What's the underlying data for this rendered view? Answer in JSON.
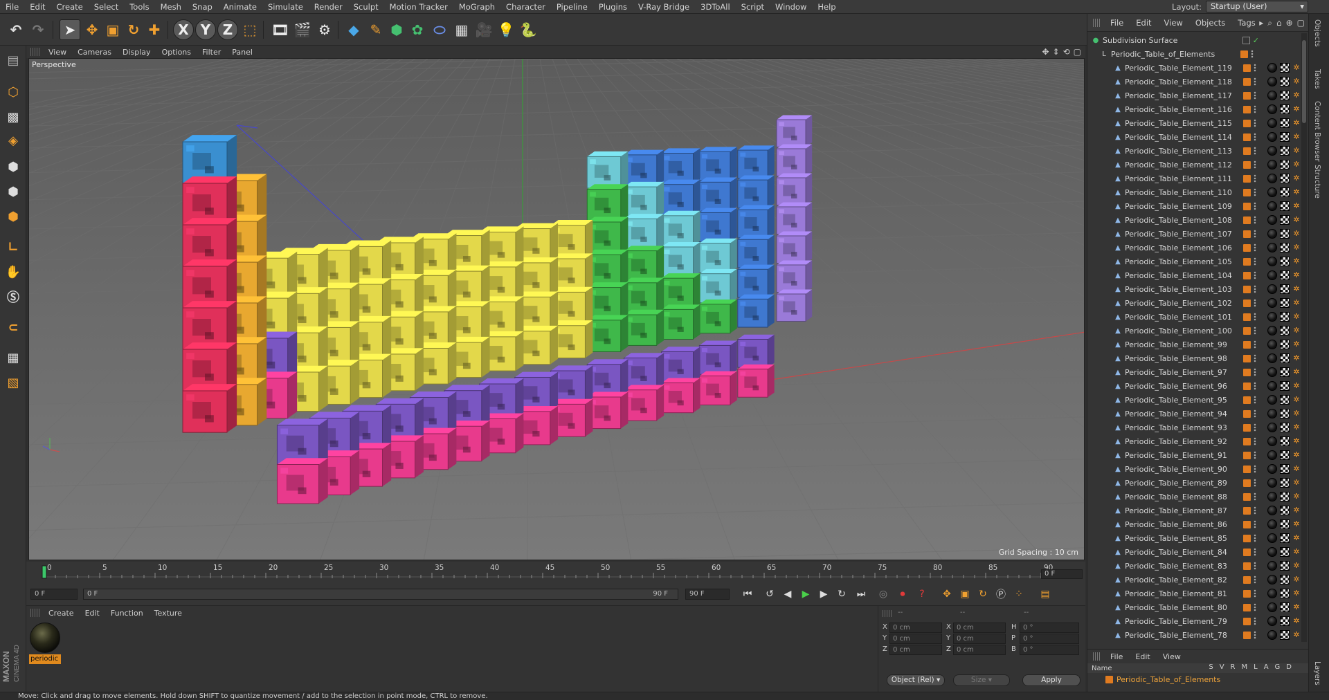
{
  "menubar": {
    "items": [
      "File",
      "Edit",
      "Create",
      "Select",
      "Tools",
      "Mesh",
      "Snap",
      "Animate",
      "Simulate",
      "Render",
      "Sculpt",
      "Motion Tracker",
      "MoGraph",
      "Character",
      "Pipeline",
      "Plugins",
      "V-Ray Bridge",
      "3DToAll",
      "Script",
      "Window",
      "Help"
    ],
    "layout_label": "Layout:",
    "layout_value": "Startup (User)"
  },
  "viewport": {
    "menu": [
      "View",
      "Cameras",
      "Display",
      "Options",
      "Filter",
      "Panel"
    ],
    "label": "Perspective",
    "grid_spacing": "Grid Spacing : 10 cm"
  },
  "timeline": {
    "ticks": [
      "0",
      "5",
      "10",
      "15",
      "20",
      "25",
      "30",
      "35",
      "40",
      "45",
      "50",
      "55",
      "60",
      "65",
      "70",
      "75",
      "80",
      "85",
      "90"
    ],
    "current_frame": "0 F"
  },
  "transport": {
    "start_field": "0 F",
    "range_start": "0 F",
    "range_end": "90 F",
    "end_field": "90 F"
  },
  "material_manager": {
    "menu": [
      "Create",
      "Edit",
      "Function",
      "Texture"
    ],
    "material_name": "periodic"
  },
  "coordinates": {
    "header_left": "--",
    "header_mid": "--",
    "header_right": "--",
    "rows": [
      {
        "axis": "X",
        "pos": "0 cm",
        "axis2": "X",
        "size": "0 cm",
        "axis3": "H",
        "rot": "0 °"
      },
      {
        "axis": "Y",
        "pos": "0 cm",
        "axis2": "Y",
        "size": "0 cm",
        "axis3": "P",
        "rot": "0 °"
      },
      {
        "axis": "Z",
        "pos": "0 cm",
        "axis2": "Z",
        "size": "0 cm",
        "axis3": "B",
        "rot": "0 °"
      }
    ],
    "mode": "Object (Rel)",
    "size_mode": "Size",
    "apply": "Apply"
  },
  "object_manager": {
    "menu": [
      "File",
      "Edit",
      "View",
      "Objects",
      "Tags"
    ],
    "root": "Subdivision Surface",
    "group": "Periodic_Table_of_Elements",
    "elements": [
      "Periodic_Table_Element_119",
      "Periodic_Table_Element_118",
      "Periodic_Table_Element_117",
      "Periodic_Table_Element_116",
      "Periodic_Table_Element_115",
      "Periodic_Table_Element_114",
      "Periodic_Table_Element_113",
      "Periodic_Table_Element_112",
      "Periodic_Table_Element_111",
      "Periodic_Table_Element_110",
      "Periodic_Table_Element_109",
      "Periodic_Table_Element_108",
      "Periodic_Table_Element_107",
      "Periodic_Table_Element_106",
      "Periodic_Table_Element_105",
      "Periodic_Table_Element_104",
      "Periodic_Table_Element_103",
      "Periodic_Table_Element_102",
      "Periodic_Table_Element_101",
      "Periodic_Table_Element_100",
      "Periodic_Table_Element_99",
      "Periodic_Table_Element_98",
      "Periodic_Table_Element_97",
      "Periodic_Table_Element_96",
      "Periodic_Table_Element_95",
      "Periodic_Table_Element_94",
      "Periodic_Table_Element_93",
      "Periodic_Table_Element_92",
      "Periodic_Table_Element_91",
      "Periodic_Table_Element_90",
      "Periodic_Table_Element_89",
      "Periodic_Table_Element_88",
      "Periodic_Table_Element_87",
      "Periodic_Table_Element_86",
      "Periodic_Table_Element_85",
      "Periodic_Table_Element_84",
      "Periodic_Table_Element_83",
      "Periodic_Table_Element_82",
      "Periodic_Table_Element_81",
      "Periodic_Table_Element_80",
      "Periodic_Table_Element_79",
      "Periodic_Table_Element_78"
    ]
  },
  "layers_manager": {
    "menu": [
      "File",
      "Edit",
      "View"
    ],
    "name_header": "Name",
    "columns": [
      "S",
      "V",
      "R",
      "M",
      "L",
      "A",
      "G",
      "D"
    ],
    "row": "Periodic_Table_of_Elements"
  },
  "side_tabs": [
    "Objects",
    "Takes",
    "Content Browser",
    "Structure"
  ],
  "layers_tab": "Layers",
  "brand": {
    "maxon": "MAXON",
    "product": "CINEMA 4D"
  },
  "status": "Move: Click and drag to move elements. Hold down SHIFT to quantize movement / add to the selection in point mode, CTRL to remove.",
  "colors": {
    "alkali": "#e0305a",
    "alkaline": "#e8a830",
    "hydrogen": "#3a8fd0",
    "transition": "#e3d84a",
    "post": "#3fb84a",
    "metalloid": "#6ec9d4",
    "nonmetal": "#3f78d0",
    "noble": "#9a7ad8",
    "lanthanide": "#7a56c2",
    "actinide": "#e83a8c",
    "accent_orange": "#e07b20"
  }
}
